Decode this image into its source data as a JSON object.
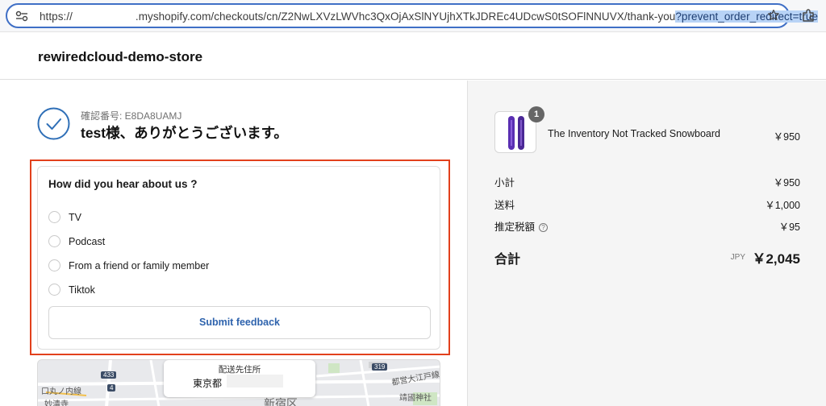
{
  "browser": {
    "url_prefix": "https://",
    "url_main": ".myshopify.com/checkouts/cn/Z2NwLXVzLWVhc3QxOjAxSlNYUjhXTkJDREc4UDcwS0tSOFlNNUVX/thank-you",
    "url_highlight": "?prevent_order_redirect=true",
    "accent_color": "#3f6fc6"
  },
  "store": {
    "name": "rewiredcloud-demo-store"
  },
  "confirmation": {
    "number_label": "確認番号: E8DA8UAMJ",
    "thanks": "test様、ありがとうございます。"
  },
  "survey": {
    "title": "How did you hear about us ?",
    "options": [
      {
        "label": "TV"
      },
      {
        "label": "Podcast"
      },
      {
        "label": "From a friend or family member"
      },
      {
        "label": "Tiktok"
      }
    ],
    "submit_label": "Submit feedback",
    "highlight_color": "#e2401c"
  },
  "order": {
    "product": {
      "name": "The Inventory Not Tracked Snowboard",
      "price": "￥950",
      "quantity": "1"
    },
    "subtotal_label": "小計",
    "subtotal_value": "￥950",
    "shipping_label": "送料",
    "shipping_value": "￥1,000",
    "tax_label": "推定税額",
    "tax_value": "￥95",
    "total_label": "合計",
    "total_currency": "JPY",
    "total_value": "￥2,045"
  },
  "map": {
    "labels": {
      "route_433": "433",
      "route_4": "4",
      "route_319": "319",
      "line_marunouchi": "口丸ノ内線",
      "toden": "都営大江戸線",
      "myogadani": "妙清寺",
      "shinjuku": "新宿区",
      "yasukuni": "靖國神社"
    },
    "address_title": "配送先住所",
    "address_value": "東京都"
  }
}
